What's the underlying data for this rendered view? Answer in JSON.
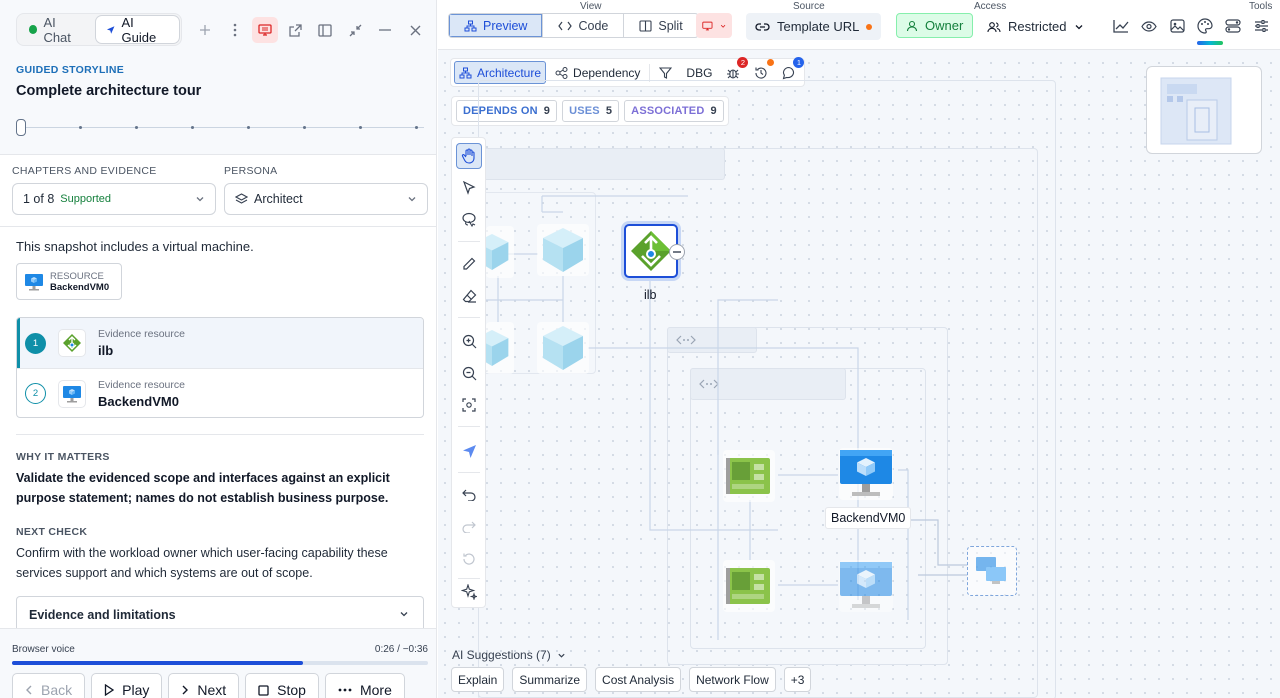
{
  "left_panel": {
    "tabs": [
      {
        "label": "AI Chat",
        "active": false
      },
      {
        "label": "AI Guide",
        "active": true
      }
    ],
    "header_icons": [
      "plus-icon",
      "more-vertical-icon",
      "presentation-icon",
      "open-external-icon",
      "sidebar-icon",
      "collapse-icon",
      "minimize-icon",
      "close-icon"
    ],
    "storyline": {
      "label": "GUIDED STORYLINE",
      "title": "Complete architecture tour",
      "total_steps": 8,
      "current_step": 1
    },
    "chapters": {
      "label": "CHAPTERS AND EVIDENCE",
      "value": "1 of 8",
      "status": "Supported"
    },
    "persona": {
      "label": "PERSONA",
      "value": "Architect"
    },
    "snapshot_text": "This snapshot includes a virtual machine.",
    "resource_chip": {
      "kind": "RESOURCE",
      "name": "BackendVM0"
    },
    "evidence": [
      {
        "num": "1",
        "kind": "Evidence resource",
        "name": "ilb",
        "active": true
      },
      {
        "num": "2",
        "kind": "Evidence resource",
        "name": "BackendVM0",
        "active": false
      }
    ],
    "why": {
      "label": "WHY IT MATTERS",
      "text": "Validate the evidenced scope and interfaces against an explicit purpose statement; names do not establish business purpose."
    },
    "next_check": {
      "label": "NEXT CHECK",
      "text": "Confirm with the workload owner which user-facing capability these services support and which systems are out of scope."
    },
    "accordion": {
      "label": "Evidence and limitations"
    },
    "player": {
      "voice": "Browser voice",
      "time": "0:26 / −0:36",
      "progress": 0.7,
      "buttons": {
        "back": "Back",
        "play": "Play",
        "next": "Next",
        "stop": "Stop",
        "more": "More"
      }
    }
  },
  "topbar": {
    "view": {
      "label": "View",
      "options": [
        "Preview",
        "Code",
        "Split"
      ],
      "selected": "Preview"
    },
    "source": {
      "label": "Source",
      "value": "Template URL"
    },
    "access": {
      "label": "Access",
      "owner": "Owner",
      "restricted": "Restricted"
    },
    "tools": {
      "label": "Tools",
      "icons": [
        "chart-icon",
        "eye-icon",
        "image-icon",
        "palette-icon",
        "share-icon",
        "sliders-icon"
      ]
    }
  },
  "canvas": {
    "view_modes": [
      "Architecture",
      "Dependency"
    ],
    "dbg_label": "DBG",
    "badges": {
      "bug": "2",
      "comments": "1"
    },
    "stats": [
      {
        "label": "DEPENDS ON",
        "count": "9",
        "color": "#3b6fd0"
      },
      {
        "label": "USES",
        "count": "5",
        "color": "#6b8fd6"
      },
      {
        "label": "ASSOCIATED",
        "count": "9",
        "color": "#7c6fd6"
      }
    ],
    "tools": [
      "hand-icon",
      "pointer-icon",
      "lasso-icon",
      "pencil-icon",
      "eraser-icon",
      "zoom-in-icon",
      "zoom-out-icon",
      "fit-view-icon",
      "navigate-icon",
      "undo-icon",
      "redo-icon",
      "reset-icon",
      "sparkle-icon"
    ],
    "nodes": {
      "ilb": "ilb",
      "vm": "BackendVM0"
    },
    "suggestions": {
      "label": "AI Suggestions (7)",
      "chips": [
        "Explain",
        "Summarize",
        "Cost Analysis",
        "Network Flow",
        "+3"
      ]
    },
    "colors": {
      "accent": "#1d4ed8",
      "teal": "#0f8fa8",
      "load_balancer": "#5aa12c"
    }
  }
}
